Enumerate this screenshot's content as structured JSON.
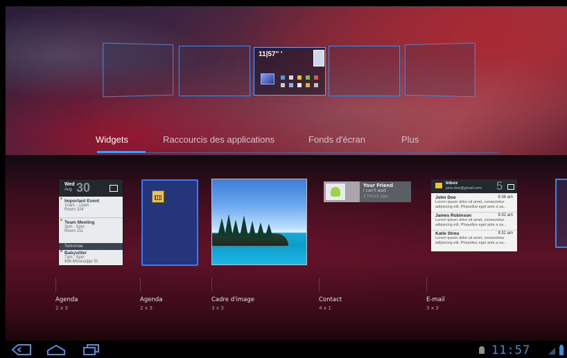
{
  "homescreen": {
    "mini_clock": "11|57'' '"
  },
  "tabs": [
    {
      "label": "Widgets"
    },
    {
      "label": "Raccourcis des applications"
    },
    {
      "label": "Fonds d'écran"
    },
    {
      "label": "Plus"
    }
  ],
  "agenda_preview": {
    "day_name": "Wed",
    "month": "Aug",
    "day_number": "30",
    "events": [
      {
        "title": "Important Event",
        "time": "10am - 12am",
        "place": "Room 324"
      },
      {
        "title": "Team Meeting",
        "time": "3pm - 5pm",
        "place": "Room 211"
      }
    ],
    "tomorrow_label": "Tomorrow",
    "tomorrow_event": {
      "title": "Babysitter",
      "time": "7am - 5pm",
      "place": "696 Mississippi St"
    }
  },
  "contact_preview": {
    "name": "Your Friend",
    "message": "I can't wait",
    "time": "2 hours ago"
  },
  "email_preview": {
    "inbox": "Inbox",
    "account": "jane.doe@gmail.com",
    "count": "5",
    "messages": [
      {
        "from": "John Doe",
        "time": "9:38 am",
        "line1": "Lorem ipsum dolor sit amet, consectetur",
        "line2": "adipiscing elit. Phasellus eget ante a sa..."
      },
      {
        "from": "James Robinson",
        "time": "9:32 am",
        "line1": "Lorem ipsum dolor sit amet, consectetur",
        "line2": "adipiscing elit. Phasellus eget ante a sa..."
      },
      {
        "from": "Katie Streu",
        "time": "9:32 am",
        "line1": "Lorem ipsum dolor sit amet, consectetur",
        "line2": "adipiscing elit. Phasellus eget ante a sa..."
      }
    ]
  },
  "widgets": [
    {
      "name": "Agenda",
      "size": "2 x 3"
    },
    {
      "name": "Agenda",
      "size": "2 x 3"
    },
    {
      "name": "Cadre d'image",
      "size": "3 x 3"
    },
    {
      "name": "Contact",
      "size": "4 x 1"
    },
    {
      "name": "E-mail",
      "size": "3 x 3"
    }
  ],
  "system_bar": {
    "clock": "11:57",
    "icons": [
      "back-icon",
      "home-icon",
      "recent-apps-icon",
      "android-notification-icon",
      "signal-icon",
      "battery-icon"
    ],
    "accent_color": "#3b8fd8"
  }
}
